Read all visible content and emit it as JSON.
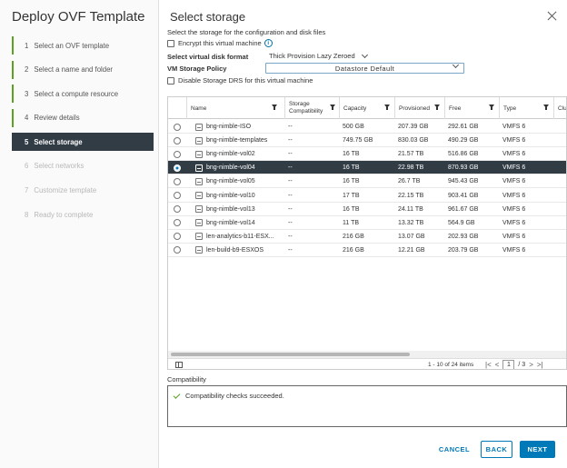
{
  "wizard": {
    "title": "Deploy OVF Template",
    "steps": [
      {
        "num": "1",
        "label": "Select an OVF template"
      },
      {
        "num": "2",
        "label": "Select a name and folder"
      },
      {
        "num": "3",
        "label": "Select a compute resource"
      },
      {
        "num": "4",
        "label": "Review details"
      },
      {
        "num": "5",
        "label": "Select storage"
      },
      {
        "num": "6",
        "label": "Select networks"
      },
      {
        "num": "7",
        "label": "Customize template"
      },
      {
        "num": "8",
        "label": "Ready to complete"
      }
    ]
  },
  "page": {
    "title": "Select storage",
    "subtitle": "Select the storage for the configuration and disk files",
    "encrypt_label": "Encrypt this virtual machine",
    "disk_format_label": "Select virtual disk format",
    "disk_format_value": "Thick Provision Lazy Zeroed",
    "policy_label": "VM Storage Policy",
    "policy_value": "Datastore Default",
    "disable_drs_label": "Disable Storage DRS for this virtual machine"
  },
  "grid": {
    "columns": [
      "Name",
      "Storage Compatibility",
      "Capacity",
      "Provisioned",
      "Free",
      "Type",
      "Clu"
    ],
    "rows": [
      {
        "name": "bng-nimble-ISO",
        "compat": "--",
        "capacity": "500 GB",
        "provisioned": "207.39 GB",
        "free": "292.61 GB",
        "type": "VMFS 6"
      },
      {
        "name": "bng-nimble-templates",
        "compat": "--",
        "capacity": "749.75 GB",
        "provisioned": "830.03 GB",
        "free": "490.29 GB",
        "type": "VMFS 6"
      },
      {
        "name": "bng-nimble-vol02",
        "compat": "--",
        "capacity": "16 TB",
        "provisioned": "21.57 TB",
        "free": "516.86 GB",
        "type": "VMFS 6"
      },
      {
        "name": "bng-nimble-vol04",
        "compat": "--",
        "capacity": "16 TB",
        "provisioned": "22.98 TB",
        "free": "870.93 GB",
        "type": "VMFS 6"
      },
      {
        "name": "bng-nimble-vol05",
        "compat": "--",
        "capacity": "16 TB",
        "provisioned": "26.7 TB",
        "free": "945.43 GB",
        "type": "VMFS 6"
      },
      {
        "name": "bng-nimble-vol10",
        "compat": "--",
        "capacity": "17 TB",
        "provisioned": "22.15 TB",
        "free": "903.41 GB",
        "type": "VMFS 6"
      },
      {
        "name": "bng-nimble-vol13",
        "compat": "--",
        "capacity": "16 TB",
        "provisioned": "24.11 TB",
        "free": "961.67 GB",
        "type": "VMFS 6"
      },
      {
        "name": "bng-nimble-vol14",
        "compat": "--",
        "capacity": "11 TB",
        "provisioned": "13.32 TB",
        "free": "564.9 GB",
        "type": "VMFS 6"
      },
      {
        "name": "len-analytics-b11-ESX...",
        "compat": "--",
        "capacity": "216 GB",
        "provisioned": "13.07 GB",
        "free": "202.93 GB",
        "type": "VMFS 6"
      },
      {
        "name": "len-build-b9-ESXOS",
        "compat": "--",
        "capacity": "216 GB",
        "provisioned": "12.21 GB",
        "free": "203.79 GB",
        "type": "VMFS 6"
      }
    ],
    "items_info": "1 - 10 of 24 items",
    "page_current": "1",
    "page_total": "/ 3",
    "first": "|<",
    "prev": "<",
    "next": ">",
    "last": ">|"
  },
  "compatibility": {
    "label": "Compatibility",
    "message": "Compatibility checks succeeded."
  },
  "buttons": {
    "cancel": "CANCEL",
    "back": "BACK",
    "next": "NEXT"
  },
  "colors": {
    "accent": "#0079b8",
    "selected_row": "#313c45",
    "done_step": "#5aa220"
  }
}
